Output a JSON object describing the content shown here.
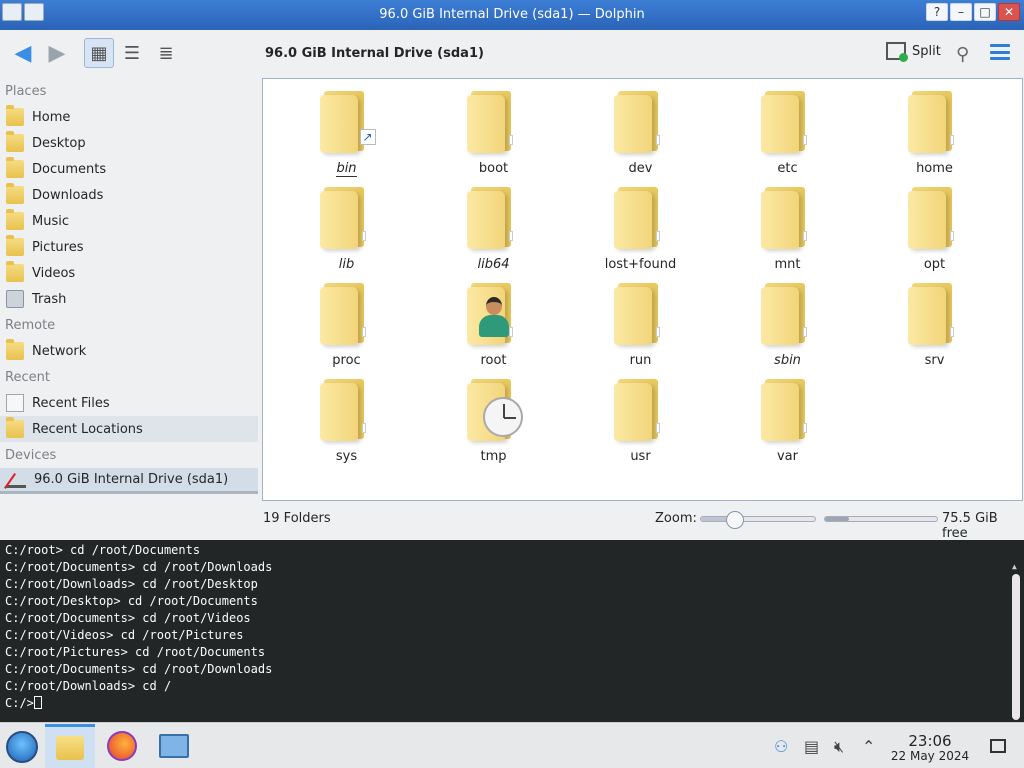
{
  "window": {
    "title": "96.0 GiB Internal Drive (sda1) — Dolphin"
  },
  "toolbar": {
    "location_title": "96.0 GiB Internal Drive (sda1)",
    "split_label": "Split"
  },
  "sidebar": {
    "sections": [
      {
        "label": "Places",
        "items": [
          {
            "label": "Home",
            "icon": "home-folder-icon"
          },
          {
            "label": "Desktop",
            "icon": "desktop-folder-icon"
          },
          {
            "label": "Documents",
            "icon": "documents-folder-icon"
          },
          {
            "label": "Downloads",
            "icon": "downloads-folder-icon"
          },
          {
            "label": "Music",
            "icon": "music-folder-icon"
          },
          {
            "label": "Pictures",
            "icon": "pictures-folder-icon"
          },
          {
            "label": "Videos",
            "icon": "videos-folder-icon"
          },
          {
            "label": "Trash",
            "icon": "trash-icon"
          }
        ]
      },
      {
        "label": "Remote",
        "items": [
          {
            "label": "Network",
            "icon": "network-folder-icon"
          }
        ]
      },
      {
        "label": "Recent",
        "items": [
          {
            "label": "Recent Files",
            "icon": "recent-files-icon"
          },
          {
            "label": "Recent Locations",
            "icon": "recent-locations-icon"
          }
        ]
      },
      {
        "label": "Devices",
        "items": [
          {
            "label": "96.0 GiB Internal Drive (sda1)",
            "icon": "drive-icon"
          }
        ]
      }
    ]
  },
  "folders": [
    {
      "name": "bin",
      "symlink": true
    },
    {
      "name": "boot"
    },
    {
      "name": "dev"
    },
    {
      "name": "etc"
    },
    {
      "name": "home"
    },
    {
      "name": "lib",
      "symlink": true
    },
    {
      "name": "lib64",
      "symlink": true
    },
    {
      "name": "lost+found"
    },
    {
      "name": "mnt"
    },
    {
      "name": "opt"
    },
    {
      "name": "proc"
    },
    {
      "name": "root",
      "overlay": "user"
    },
    {
      "name": "run"
    },
    {
      "name": "sbin",
      "symlink": true
    },
    {
      "name": "srv"
    },
    {
      "name": "sys"
    },
    {
      "name": "tmp",
      "overlay": "clock"
    },
    {
      "name": "usr"
    },
    {
      "name": "var"
    }
  ],
  "statusbar": {
    "count": "19 Folders",
    "zoom_label": "Zoom:",
    "zoom_level": 0.3,
    "space_used_fraction": 0.21,
    "free_space": "75.5 GiB free"
  },
  "terminal": {
    "lines": [
      "C:/root> cd /root/Documents",
      "C:/root/Documents> cd /root/Downloads",
      "C:/root/Downloads> cd /root/Desktop",
      "C:/root/Desktop> cd /root/Documents",
      "C:/root/Documents> cd /root/Videos",
      "C:/root/Videos> cd /root/Pictures",
      "C:/root/Pictures> cd /root/Documents",
      "C:/root/Documents> cd /root/Downloads",
      "C:/root/Downloads> cd /"
    ],
    "prompt": "C:/>"
  },
  "taskbar": {
    "time": "23:06",
    "date": "22 May 2024"
  }
}
